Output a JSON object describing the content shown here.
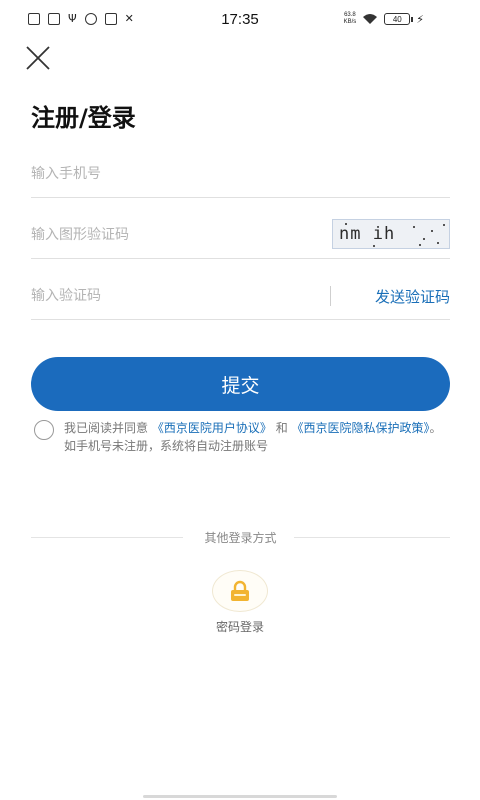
{
  "status_bar": {
    "time": "17:35",
    "net_speed_value": "63.8",
    "net_speed_unit": "KB/s",
    "battery": "40"
  },
  "page": {
    "title": "注册/登录"
  },
  "form": {
    "phone_placeholder": "输入手机号",
    "captcha_placeholder": "输入图形验证码",
    "captcha_text": "nm ih",
    "sms_placeholder": "输入验证码",
    "send_sms_label": "发送验证码",
    "submit_label": "提交"
  },
  "agreement": {
    "prefix": "我已阅读并同意",
    "user_agreement_link": "《西京医院用户协议》",
    "and": "和",
    "privacy_link": "《西京医院隐私保护政策》",
    "suffix": "。如手机号未注册，系统将自动注册账号"
  },
  "other_login": {
    "heading": "其他登录方式",
    "password_login_label": "密码登录"
  },
  "colors": {
    "primary": "#1b6bbd",
    "link": "#1a6fb8",
    "lock": "#f2b431"
  }
}
